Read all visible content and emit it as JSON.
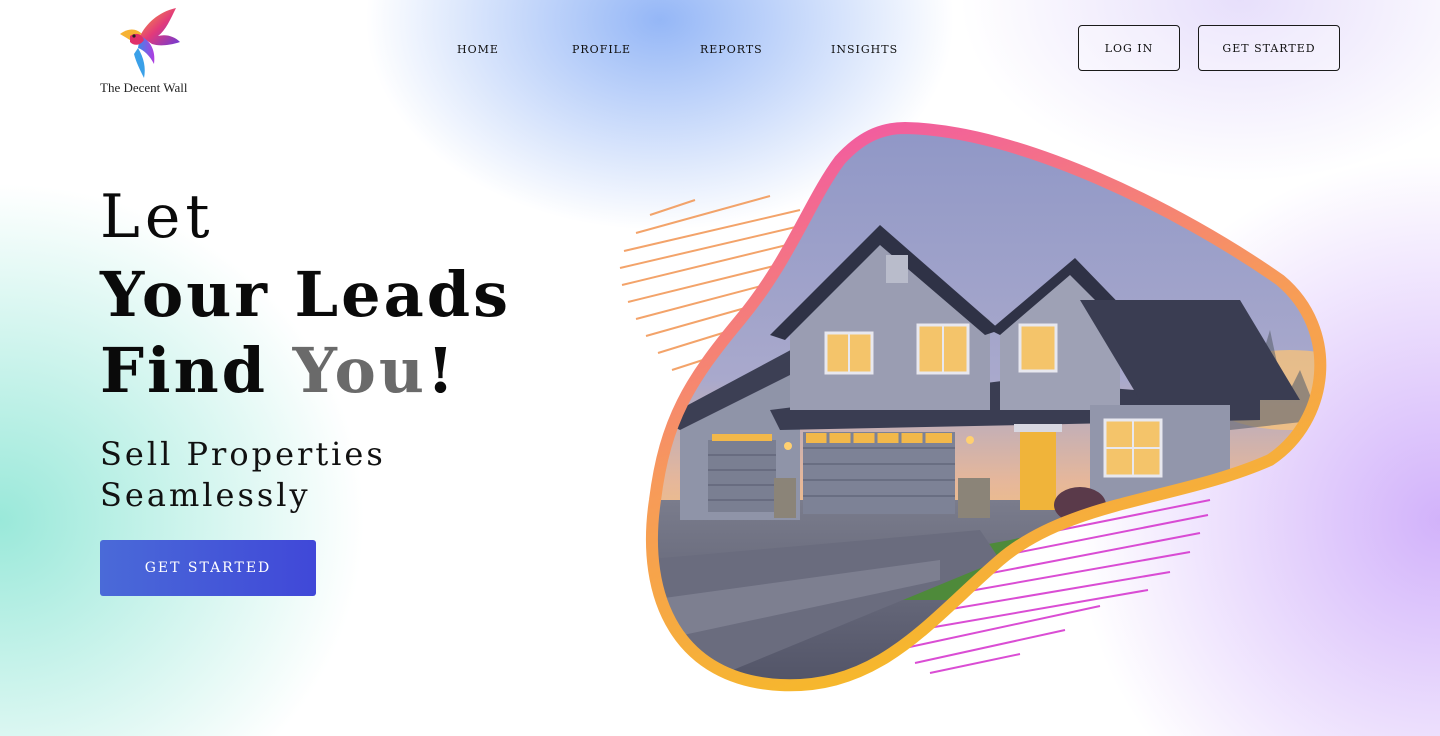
{
  "brand": {
    "name": "The Decent Wall",
    "logo_icon": "bird-icon"
  },
  "nav": {
    "items": [
      {
        "label": "HOME"
      },
      {
        "label": "PROFILE"
      },
      {
        "label": "REPORTS"
      },
      {
        "label": "INSIGHTS"
      }
    ]
  },
  "header": {
    "login_label": "LOG IN",
    "get_started_label": "GET STARTED"
  },
  "hero": {
    "line1": "Let",
    "line2": "Your Leads",
    "line3_a": "Find ",
    "line3_b": "You",
    "line3_c": "!",
    "subtitle_1": "Sell Properties",
    "subtitle_2": "Seamlessly",
    "cta_label": "GET STARTED",
    "image_icon": "house-photo"
  },
  "colors": {
    "accent": "#4348d8",
    "blob_gradient_start": "#f25ca0",
    "blob_gradient_mid": "#f79a5a",
    "blob_gradient_end": "#f6c21c",
    "stripes_orange": "#f29a5a",
    "stripes_magenta": "#d63ad0"
  }
}
